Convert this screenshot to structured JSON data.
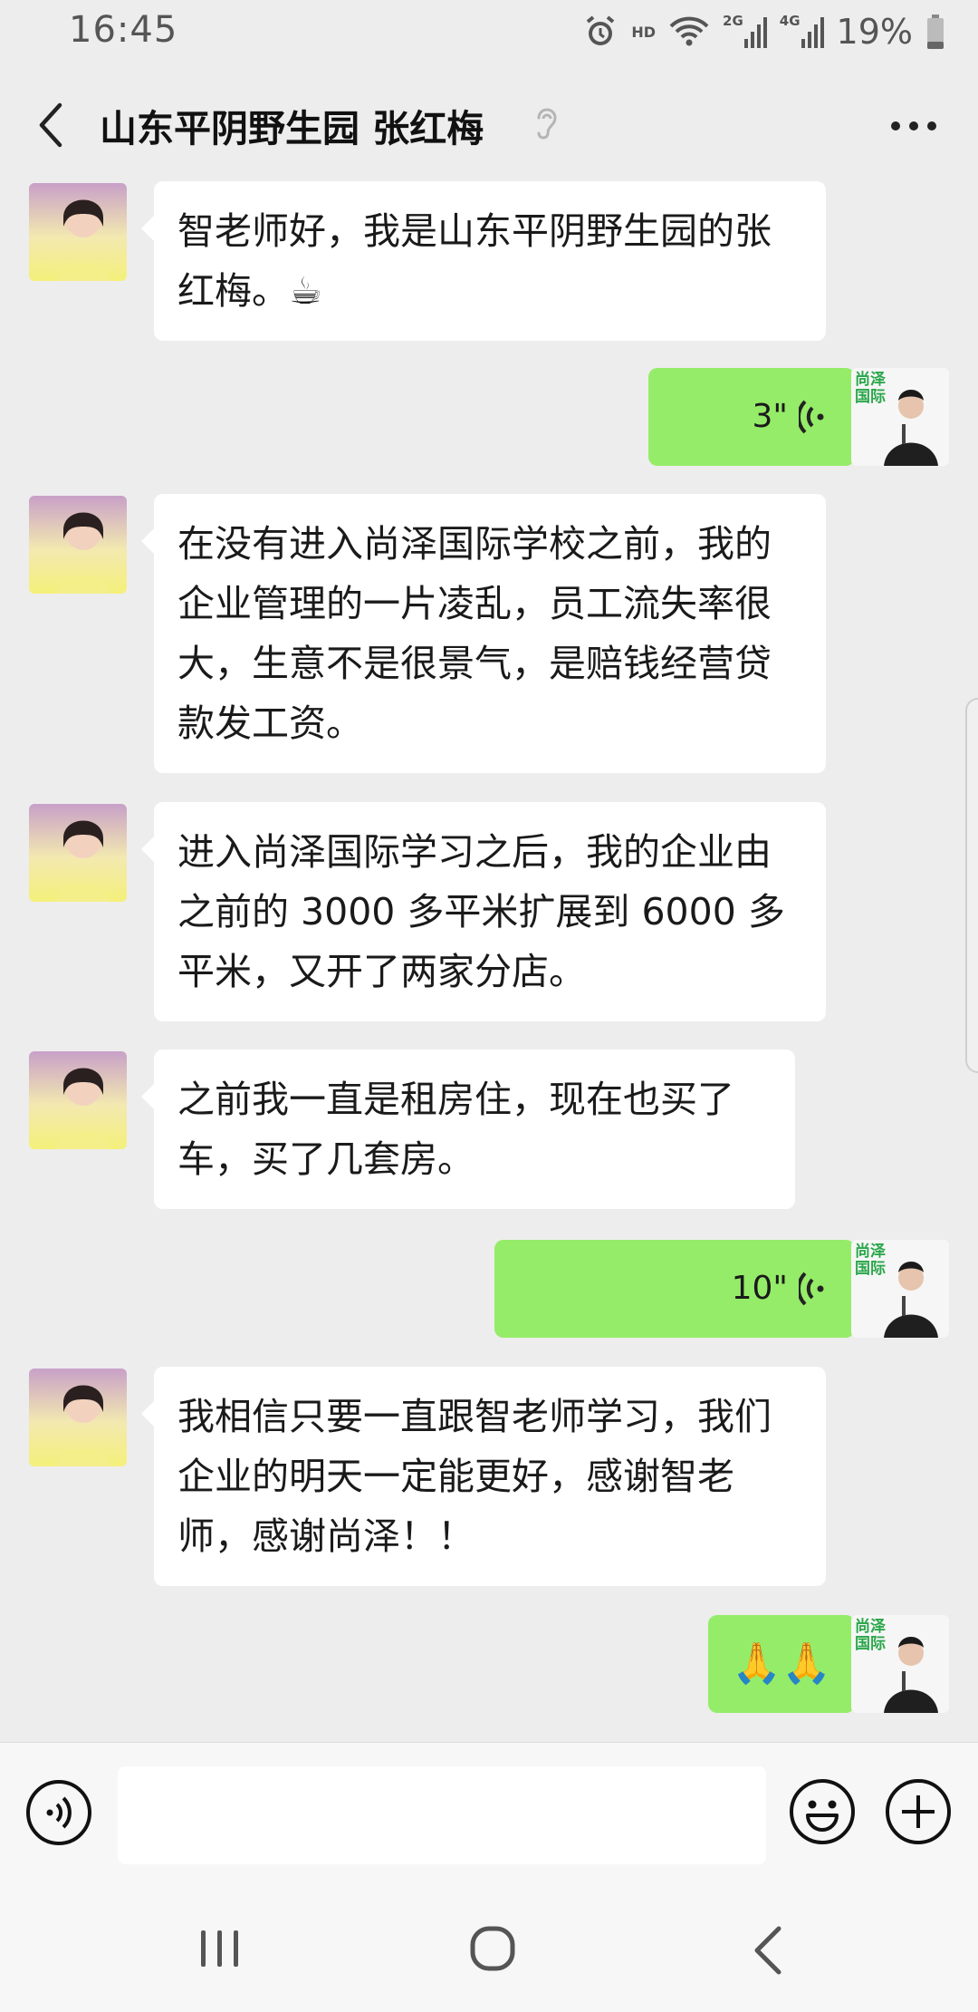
{
  "status_bar": {
    "time": "16:45",
    "hd_label": "HD",
    "network_2g": "2G",
    "network_4g": "4G",
    "battery": "19%"
  },
  "header": {
    "title": "山东平阴野生园  张红梅"
  },
  "avatars": {
    "sender_logo_line1": "尚泽",
    "sender_logo_line2": "国际"
  },
  "messages": [
    {
      "side": "left",
      "type": "text",
      "text": "智老师好，我是山东平阴野生园的张红梅。☕"
    },
    {
      "side": "right",
      "type": "voice",
      "duration": "3\""
    },
    {
      "side": "left",
      "type": "text",
      "text": "在没有进入尚泽国际学校之前，我的企业管理的一片凌乱，员工流失率很大，生意不是很景气，是赔钱经营贷款发工资。"
    },
    {
      "side": "left",
      "type": "text",
      "text": "进入尚泽国际学习之后，我的企业由之前的 3000 多平米扩展到 6000 多平米，又开了两家分店。"
    },
    {
      "side": "left",
      "type": "text",
      "text": "之前我一直是租房住，现在也买了车，买了几套房。"
    },
    {
      "side": "right",
      "type": "voice",
      "duration": "10\""
    },
    {
      "side": "left",
      "type": "text",
      "text": "我相信只要一直跟智老师学习，我们企业的明天一定能更好，感谢智老师，感谢尚泽！！"
    },
    {
      "side": "right",
      "type": "emoji",
      "text": "🙏🙏"
    }
  ],
  "input": {
    "placeholder": ""
  },
  "colors": {
    "background": "#ededed",
    "sent_bubble": "#95ec69",
    "received_bubble": "#ffffff"
  }
}
